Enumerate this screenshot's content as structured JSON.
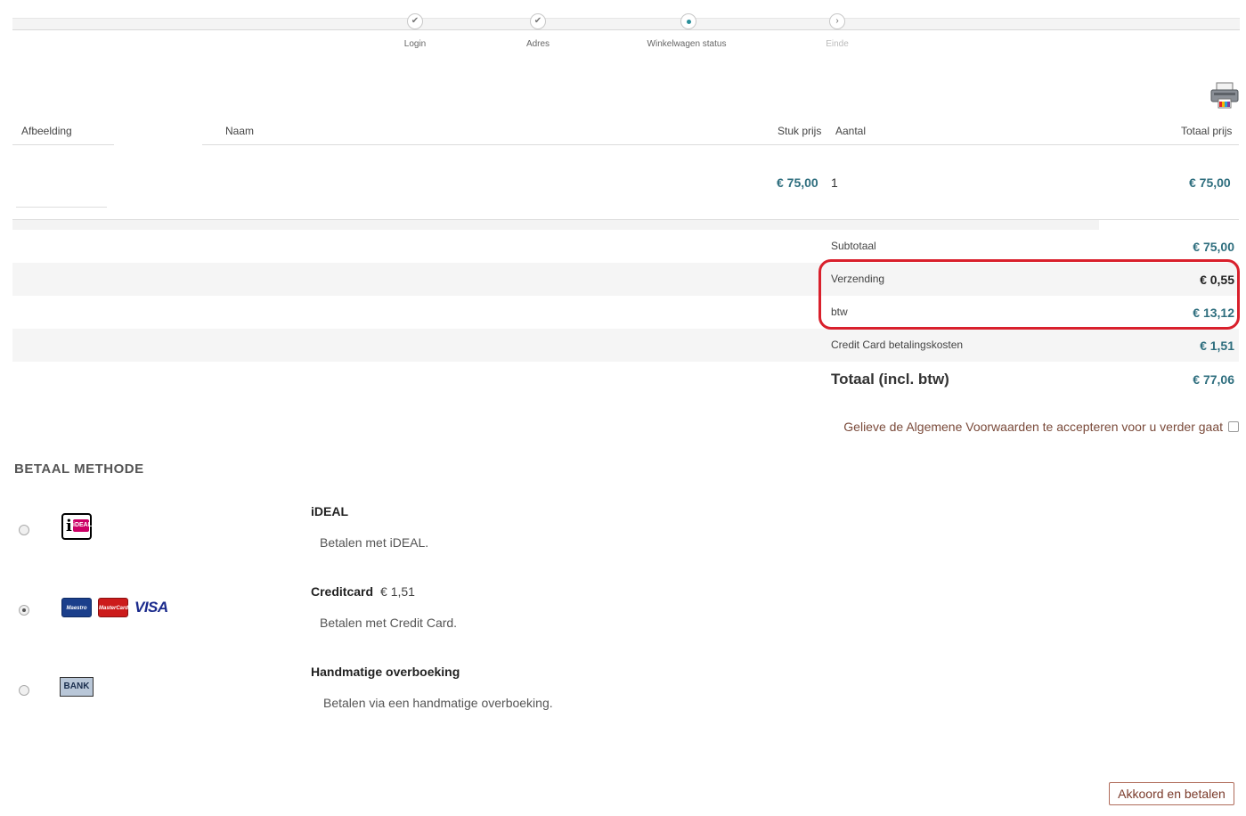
{
  "steps": [
    {
      "label": "Login",
      "state": "done"
    },
    {
      "label": "Adres",
      "state": "done"
    },
    {
      "label": "Winkelwagen status",
      "state": "current"
    },
    {
      "label": "Einde",
      "state": "future"
    }
  ],
  "cart": {
    "headers": {
      "image": "Afbeelding",
      "name": "Naam",
      "unit_price": "Stuk prijs",
      "quantity": "Aantal",
      "total_price": "Totaal prijs"
    },
    "rows": [
      {
        "unit_price": "€ 75,00",
        "quantity": "1",
        "total_price": "€ 75,00"
      }
    ]
  },
  "summary": {
    "subtotal_label": "Subtotaal",
    "subtotal_value": "€ 75,00",
    "shipping_label": "Verzending",
    "shipping_value": "€ 0,55",
    "vat_label": "btw",
    "vat_value": "€ 13,12",
    "cc_fee_label": "Credit Card betalingskosten",
    "cc_fee_value": "€ 1,51",
    "total_label": "Totaal (incl. btw)",
    "total_value": "€ 77,06"
  },
  "terms": {
    "text": "Gelieve de Algemene Voorwaarden te accepteren voor u verder gaat",
    "checked": false
  },
  "payment": {
    "title": "BETAAL METHODE",
    "methods": [
      {
        "name": "iDEAL",
        "fee": "",
        "description": "Betalen met iDEAL.",
        "selected": false,
        "logo_text": "iDEAL"
      },
      {
        "name": "Creditcard",
        "fee": "€ 1,51",
        "description": "Betalen met Credit Card.",
        "selected": true,
        "logos": [
          "Maestro",
          "MasterCard",
          "VISA"
        ]
      },
      {
        "name": "Handmatige overboeking",
        "fee": "",
        "description": "Betalen via een handmatige overboeking.",
        "selected": false,
        "logo_text": "BANK"
      }
    ]
  },
  "actions": {
    "pay_button": "Akkoord en betalen"
  },
  "colors": {
    "price": "#2e6e7e",
    "highlight": "#d9202c",
    "terms_text": "#7a4a3a",
    "step_current": "#2a8f9a"
  }
}
